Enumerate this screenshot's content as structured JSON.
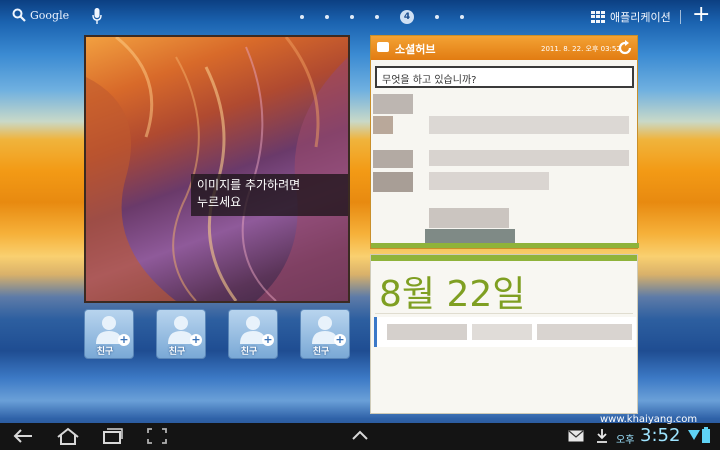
{
  "statusbar": {
    "search_label": "Google",
    "page_indicator": "4",
    "apps_label": "애플리케이션"
  },
  "photo_widget": {
    "caption_line1": "이미지를 추가하려면",
    "caption_line2": "누르세요"
  },
  "friends": [
    {
      "label": "친구"
    },
    {
      "label": "친구"
    },
    {
      "label": "친구"
    },
    {
      "label": "친구"
    }
  ],
  "social_hub": {
    "title": "소셜허브",
    "datetime": "2011. 8. 22. 오후 03:52",
    "input_placeholder": "무엇을 하고 있습니까?",
    "accent_color": "#e8871c"
  },
  "calendar": {
    "date": "8월 22일",
    "accent_color": "#7f9f22"
  },
  "navbar": {
    "watermark": "www.khaiyang.com",
    "ampm": "오후",
    "time": "3:52"
  }
}
